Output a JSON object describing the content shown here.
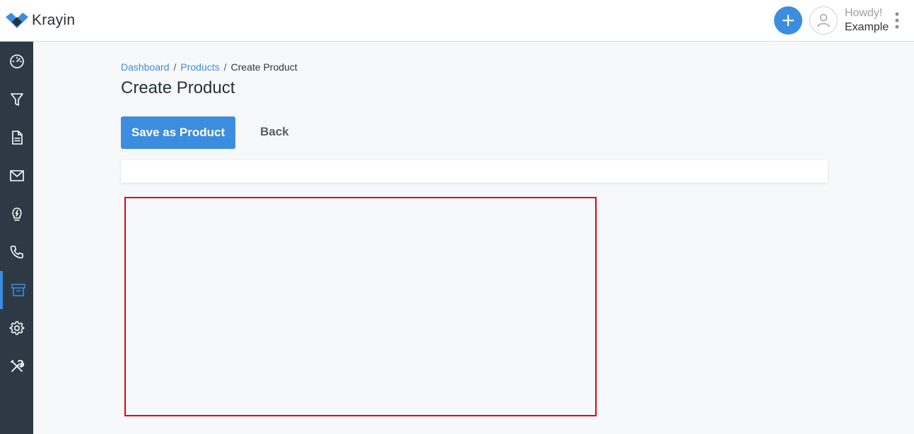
{
  "app": {
    "logo_text": "Krayin"
  },
  "header": {
    "greeting": "Howdy!",
    "user_name": "Example"
  },
  "sidebar": {
    "items": [
      {
        "name": "dashboard",
        "icon": "gauge-icon"
      },
      {
        "name": "leads",
        "icon": "filter-icon"
      },
      {
        "name": "quotes",
        "icon": "document-icon"
      },
      {
        "name": "mail",
        "icon": "mail-icon"
      },
      {
        "name": "activities",
        "icon": "lightbulb-icon"
      },
      {
        "name": "contacts",
        "icon": "phone-icon"
      },
      {
        "name": "products",
        "icon": "archive-box-icon",
        "active": true
      },
      {
        "name": "settings",
        "icon": "gear-icon"
      },
      {
        "name": "configuration",
        "icon": "tools-icon"
      }
    ]
  },
  "breadcrumb": {
    "dashboard": "Dashboard",
    "products": "Products",
    "current": "Create Product",
    "separator": "/"
  },
  "page": {
    "title": "Create Product"
  },
  "actions": {
    "save_label": "Save as Product",
    "back_label": "Back"
  },
  "colors": {
    "accent": "#3c8de0",
    "sidebar_bg": "#2d3a46",
    "highlight": "#e8000b"
  }
}
